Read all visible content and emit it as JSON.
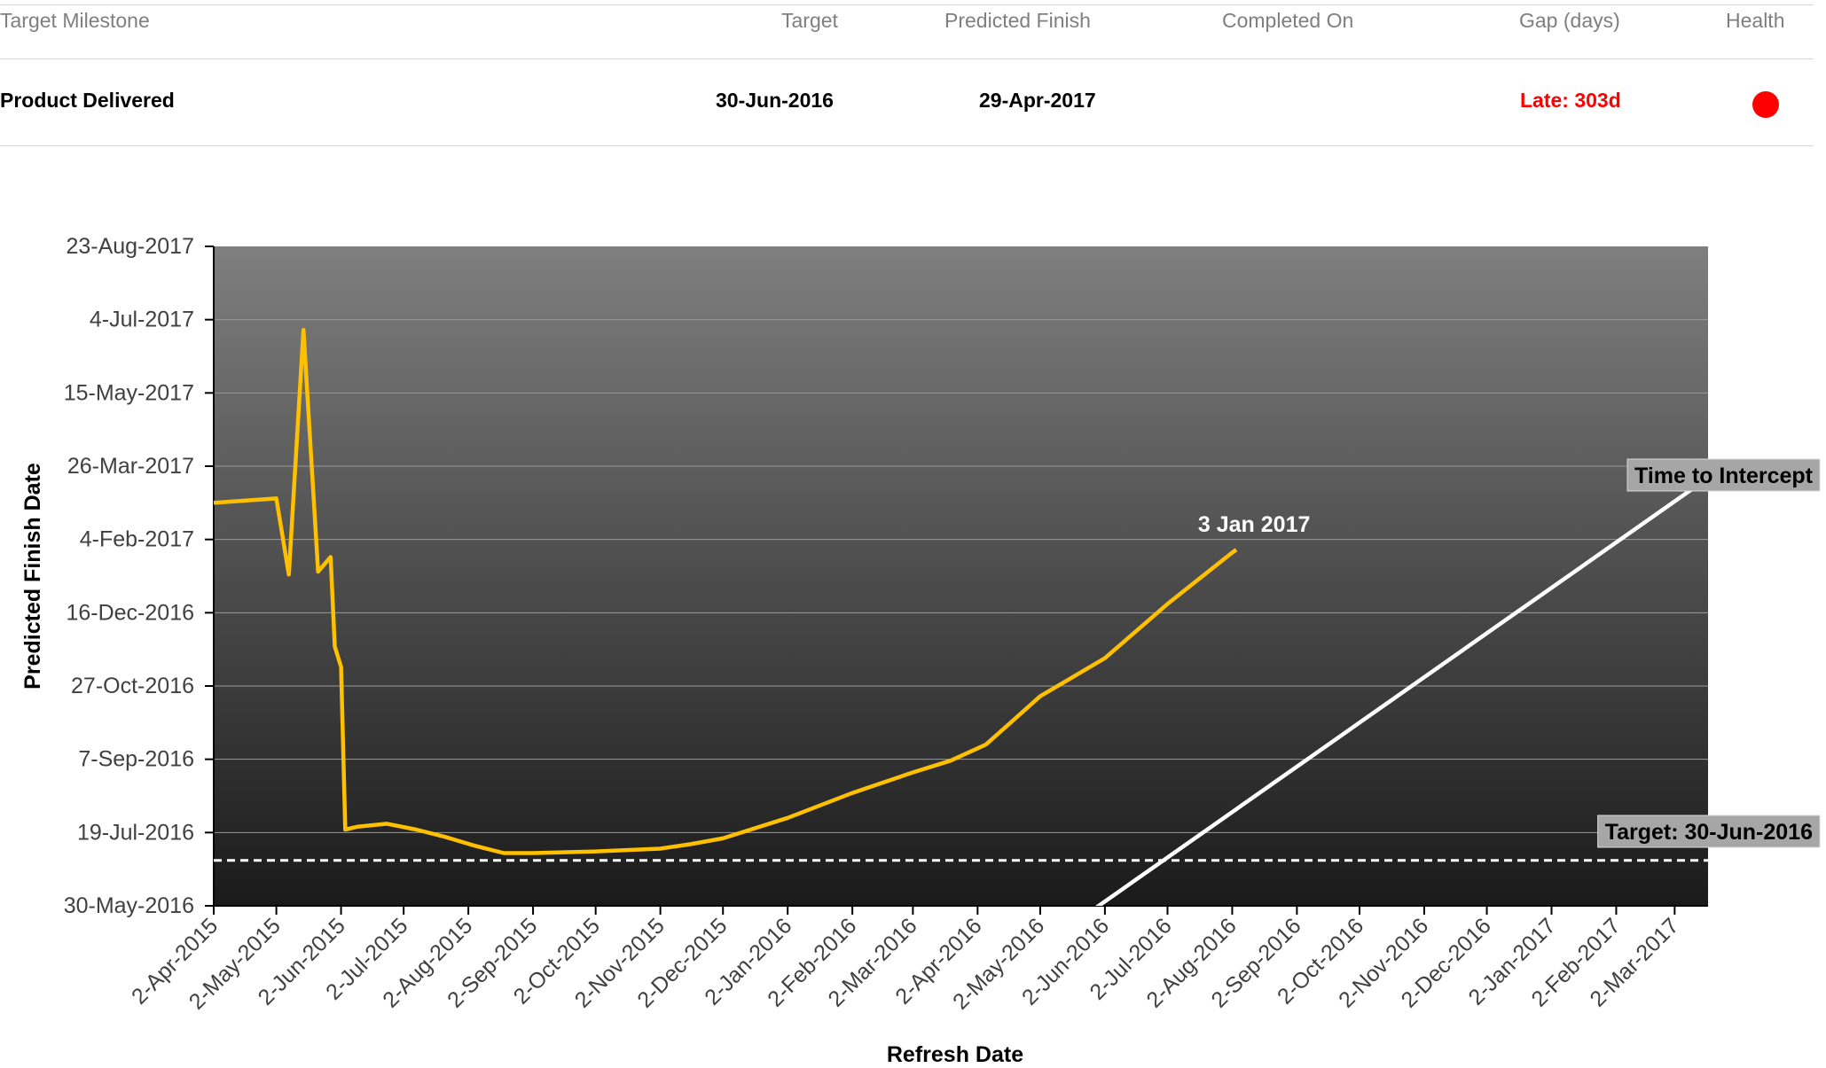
{
  "table": {
    "headers": {
      "milestone": "Target Milestone",
      "target": "Target",
      "predicted": "Predicted Finish",
      "completed": "Completed On",
      "gap": "Gap (days)",
      "health": "Health"
    },
    "row": {
      "milestone": "Product Delivered",
      "target": "30-Jun-2016",
      "predicted": "29-Apr-2017",
      "completed": "",
      "gap": "Late: 303d",
      "health_color": "#ff0000"
    }
  },
  "chart_data": {
    "type": "line",
    "xlabel": "Refresh Date",
    "ylabel": "Predicted Finish Date",
    "x_ticks": [
      "2-Apr-2015",
      "2-May-2015",
      "2-Jun-2015",
      "2-Jul-2015",
      "2-Aug-2015",
      "2-Sep-2015",
      "2-Oct-2015",
      "2-Nov-2015",
      "2-Dec-2015",
      "2-Jan-2016",
      "2-Feb-2016",
      "2-Mar-2016",
      "2-Apr-2016",
      "2-May-2016",
      "2-Jun-2016",
      "2-Jul-2016",
      "2-Aug-2016",
      "2-Sep-2016",
      "2-Oct-2016",
      "2-Nov-2016",
      "2-Dec-2016",
      "2-Jan-2017",
      "2-Feb-2017",
      "2-Mar-2017"
    ],
    "y_ticks": [
      "30-May-2016",
      "19-Jul-2016",
      "7-Sep-2016",
      "27-Oct-2016",
      "16-Dec-2016",
      "4-Feb-2017",
      "26-Mar-2017",
      "15-May-2017",
      "4-Jul-2017",
      "23-Aug-2017"
    ],
    "xlim": [
      "2015-04-02",
      "2017-03-18"
    ],
    "ylim": [
      "2016-05-30",
      "2017-08-23"
    ],
    "grid": true,
    "series": [
      {
        "color": "#ffc000",
        "points": [
          [
            "2015-04-02",
            "2017-03-01"
          ],
          [
            "2015-05-02",
            "2017-03-04"
          ],
          [
            "2015-05-08",
            "2017-01-11"
          ],
          [
            "2015-05-15",
            "2017-06-27"
          ],
          [
            "2015-05-22",
            "2017-01-13"
          ],
          [
            "2015-05-28",
            "2017-01-23"
          ],
          [
            "2015-05-30",
            "2016-11-23"
          ],
          [
            "2015-06-02",
            "2016-11-09"
          ],
          [
            "2015-06-04",
            "2016-07-21"
          ],
          [
            "2015-06-10",
            "2016-07-23"
          ],
          [
            "2015-06-24",
            "2016-07-25"
          ],
          [
            "2015-07-08",
            "2016-07-21"
          ],
          [
            "2015-07-22",
            "2016-07-16"
          ],
          [
            "2015-08-05",
            "2016-07-10"
          ],
          [
            "2015-08-19",
            "2016-07-05"
          ],
          [
            "2015-09-02",
            "2016-07-05"
          ],
          [
            "2015-10-01",
            "2016-07-06"
          ],
          [
            "2015-11-02",
            "2016-07-08"
          ],
          [
            "2015-11-16",
            "2016-07-11"
          ],
          [
            "2015-12-02",
            "2016-07-15"
          ],
          [
            "2016-01-02",
            "2016-07-29"
          ],
          [
            "2016-02-02",
            "2016-08-15"
          ],
          [
            "2016-03-02",
            "2016-08-29"
          ],
          [
            "2016-03-20",
            "2016-09-06"
          ],
          [
            "2016-04-06",
            "2016-09-17"
          ],
          [
            "2016-05-02",
            "2016-10-20"
          ],
          [
            "2016-06-02",
            "2016-11-15"
          ],
          [
            "2016-07-02",
            "2016-12-22"
          ],
          [
            "2016-08-02",
            "2017-01-26"
          ],
          [
            "2016-08-04",
            "2017-01-28"
          ]
        ]
      },
      {
        "color": "#ffffff",
        "points": [
          [
            "2016-05-29",
            "2016-05-29"
          ],
          [
            "2017-03-27",
            "2017-03-27"
          ]
        ]
      }
    ],
    "target_line": {
      "date": "2016-06-30",
      "label": "Target: 30-Jun-2016"
    },
    "annotations": {
      "end_label": "3 Jan 2017",
      "intercept_label": "Time to Intercept"
    }
  }
}
